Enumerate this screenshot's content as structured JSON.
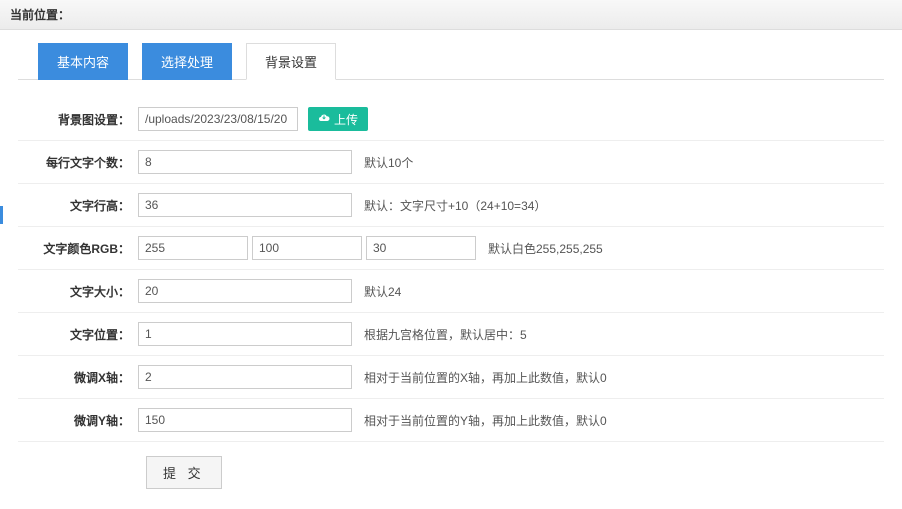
{
  "breadcrumb": "当前位置：",
  "tabs": [
    {
      "label": "基本内容",
      "active": false
    },
    {
      "label": "选择处理",
      "active": false
    },
    {
      "label": "背景设置",
      "active": true
    }
  ],
  "form": {
    "bgimage": {
      "label": "背景图设置：",
      "value": "/uploads/2023/23/08/15/20",
      "upload_label": "上传"
    },
    "chars_per_line": {
      "label": "每行文字个数：",
      "value": "8",
      "hint": "默认10个"
    },
    "line_height": {
      "label": "文字行高：",
      "value": "36",
      "hint": "默认：文字尺寸+10（24+10=34）"
    },
    "color_rgb": {
      "label": "文字颜色RGB：",
      "r": "255",
      "g": "100",
      "b": "30",
      "hint": "默认白色255,255,255"
    },
    "font_size": {
      "label": "文字大小：",
      "value": "20",
      "hint": "默认24"
    },
    "position": {
      "label": "文字位置：",
      "value": "1",
      "hint": "根据九宫格位置，默认居中：5"
    },
    "offset_x": {
      "label": "微调X轴：",
      "value": "2",
      "hint": "相对于当前位置的X轴，再加上此数值，默认0"
    },
    "offset_y": {
      "label": "微调Y轴：",
      "value": "150",
      "hint": "相对于当前位置的Y轴，再加上此数值，默认0"
    },
    "submit": "提 交"
  }
}
